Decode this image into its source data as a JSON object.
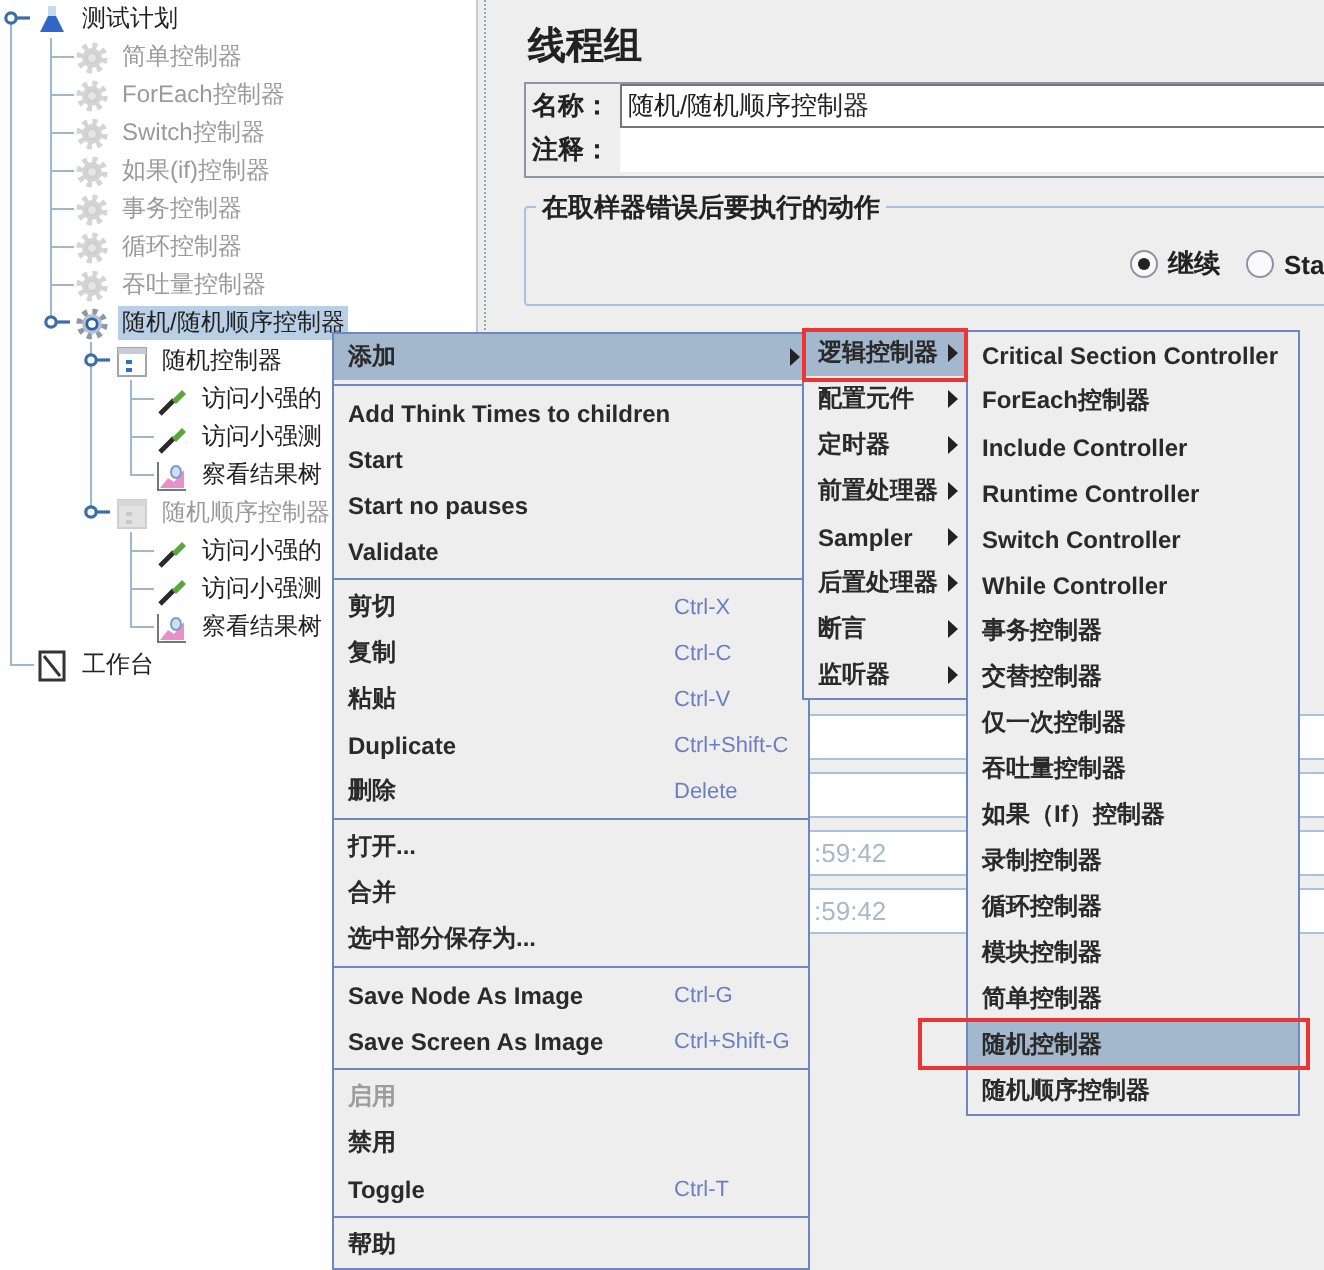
{
  "tree": [
    {
      "label": "测试计划",
      "kind": "plan",
      "disabled": false,
      "selected": false,
      "children": [
        {
          "label": "简单控制器",
          "kind": "controller",
          "disabled": true,
          "selected": false
        },
        {
          "label": "ForEach控制器",
          "kind": "controller",
          "disabled": true,
          "selected": false
        },
        {
          "label": "Switch控制器",
          "kind": "controller",
          "disabled": true,
          "selected": false
        },
        {
          "label": "如果(if)控制器",
          "kind": "controller",
          "disabled": true,
          "selected": false
        },
        {
          "label": "事务控制器",
          "kind": "controller",
          "disabled": true,
          "selected": false
        },
        {
          "label": "循环控制器",
          "kind": "controller",
          "disabled": true,
          "selected": false
        },
        {
          "label": "吞吐量控制器",
          "kind": "controller",
          "disabled": true,
          "selected": false
        },
        {
          "label": "随机/随机顺序控制器",
          "kind": "controller",
          "disabled": false,
          "selected": true,
          "children": [
            {
              "label": "随机控制器",
              "kind": "random",
              "disabled": false,
              "selected": false,
              "children": [
                {
                  "label": "访问小强的",
                  "kind": "sampler",
                  "disabled": false,
                  "selected": false
                },
                {
                  "label": "访问小强测",
                  "kind": "sampler",
                  "disabled": false,
                  "selected": false
                },
                {
                  "label": "察看结果树",
                  "kind": "listener",
                  "disabled": false,
                  "selected": false
                }
              ]
            },
            {
              "label": "随机顺序控制器",
              "kind": "random",
              "disabled": true,
              "selected": false,
              "children": [
                {
                  "label": "访问小强的",
                  "kind": "sampler",
                  "disabled": false,
                  "selected": false
                },
                {
                  "label": "访问小强测",
                  "kind": "sampler",
                  "disabled": false,
                  "selected": false
                },
                {
                  "label": "察看结果树",
                  "kind": "listener",
                  "disabled": false,
                  "selected": false
                }
              ]
            }
          ]
        }
      ]
    },
    {
      "label": "工作台",
      "kind": "workbench",
      "disabled": false,
      "selected": false
    }
  ],
  "panel": {
    "title": "线程组",
    "name_label": "名称：",
    "name_value": "随机/随机顺序控制器",
    "comment_label": "注释：",
    "error_group": {
      "title": "在取样器错误后要执行的动作",
      "options": [
        {
          "label": "继续",
          "selected": true
        },
        {
          "label": "Sta",
          "selected": false
        }
      ]
    },
    "time_fields": [
      {
        "value": ":59:42"
      },
      {
        "value": ":59:42"
      }
    ]
  },
  "context_menu": {
    "items": [
      {
        "kind": "item",
        "label": "添加",
        "submenu": true,
        "selected": true,
        "disabled": false
      },
      {
        "kind": "separator"
      },
      {
        "kind": "item",
        "label": "Add Think Times to children",
        "selected": false,
        "disabled": false
      },
      {
        "kind": "item",
        "label": "Start",
        "selected": false,
        "disabled": false
      },
      {
        "kind": "item",
        "label": "Start no pauses",
        "selected": false,
        "disabled": false
      },
      {
        "kind": "item",
        "label": "Validate",
        "selected": false,
        "disabled": false
      },
      {
        "kind": "separator"
      },
      {
        "kind": "item",
        "label": "剪切",
        "shortcut": "Ctrl-X",
        "selected": false,
        "disabled": false
      },
      {
        "kind": "item",
        "label": "复制",
        "shortcut": "Ctrl-C",
        "selected": false,
        "disabled": false
      },
      {
        "kind": "item",
        "label": "粘贴",
        "shortcut": "Ctrl-V",
        "selected": false,
        "disabled": false
      },
      {
        "kind": "item",
        "label": "Duplicate",
        "shortcut": "Ctrl+Shift-C",
        "selected": false,
        "disabled": false
      },
      {
        "kind": "item",
        "label": "删除",
        "shortcut": "Delete",
        "selected": false,
        "disabled": false
      },
      {
        "kind": "separator"
      },
      {
        "kind": "item",
        "label": "打开...",
        "selected": false,
        "disabled": false
      },
      {
        "kind": "item",
        "label": "合并",
        "selected": false,
        "disabled": false
      },
      {
        "kind": "item",
        "label": "选中部分保存为...",
        "selected": false,
        "disabled": false
      },
      {
        "kind": "separator"
      },
      {
        "kind": "item",
        "label": "Save Node As Image",
        "shortcut": "Ctrl-G",
        "selected": false,
        "disabled": false
      },
      {
        "kind": "item",
        "label": "Save Screen As Image",
        "shortcut": "Ctrl+Shift-G",
        "selected": false,
        "disabled": false
      },
      {
        "kind": "separator"
      },
      {
        "kind": "item",
        "label": "启用",
        "selected": false,
        "disabled": true
      },
      {
        "kind": "item",
        "label": "禁用",
        "selected": false,
        "disabled": false
      },
      {
        "kind": "item",
        "label": "Toggle",
        "shortcut": "Ctrl-T",
        "selected": false,
        "disabled": false
      },
      {
        "kind": "separator"
      },
      {
        "kind": "item",
        "label": "帮助",
        "selected": false,
        "disabled": false
      }
    ]
  },
  "add_submenu": {
    "items": [
      {
        "label": "逻辑控制器",
        "selected": true,
        "annotated": true
      },
      {
        "label": "配置元件",
        "selected": false,
        "annotated": false
      },
      {
        "label": "定时器",
        "selected": false,
        "annotated": false
      },
      {
        "label": "前置处理器",
        "selected": false,
        "annotated": false
      },
      {
        "label": "Sampler",
        "selected": false,
        "annotated": false
      },
      {
        "label": "后置处理器",
        "selected": false,
        "annotated": false
      },
      {
        "label": "断言",
        "selected": false,
        "annotated": false
      },
      {
        "label": "监听器",
        "selected": false,
        "annotated": false
      }
    ]
  },
  "logic_controller_submenu": {
    "items": [
      {
        "label": "Critical Section Controller",
        "selected": false,
        "annotated": false
      },
      {
        "label": "ForEach控制器",
        "selected": false,
        "annotated": false
      },
      {
        "label": "Include Controller",
        "selected": false,
        "annotated": false
      },
      {
        "label": "Runtime Controller",
        "selected": false,
        "annotated": false
      },
      {
        "label": "Switch Controller",
        "selected": false,
        "annotated": false
      },
      {
        "label": "While Controller",
        "selected": false,
        "annotated": false
      },
      {
        "label": "事务控制器",
        "selected": false,
        "annotated": false
      },
      {
        "label": "交替控制器",
        "selected": false,
        "annotated": false
      },
      {
        "label": "仅一次控制器",
        "selected": false,
        "annotated": false
      },
      {
        "label": "吞吐量控制器",
        "selected": false,
        "annotated": false
      },
      {
        "label": "如果（If）控制器",
        "selected": false,
        "annotated": false
      },
      {
        "label": "录制控制器",
        "selected": false,
        "annotated": false
      },
      {
        "label": "循环控制器",
        "selected": false,
        "annotated": false
      },
      {
        "label": "模块控制器",
        "selected": false,
        "annotated": false
      },
      {
        "label": "简单控制器",
        "selected": false,
        "annotated": false
      },
      {
        "label": "随机控制器",
        "selected": true,
        "annotated": true
      },
      {
        "label": "随机顺序控制器",
        "selected": false,
        "annotated": false
      }
    ]
  }
}
